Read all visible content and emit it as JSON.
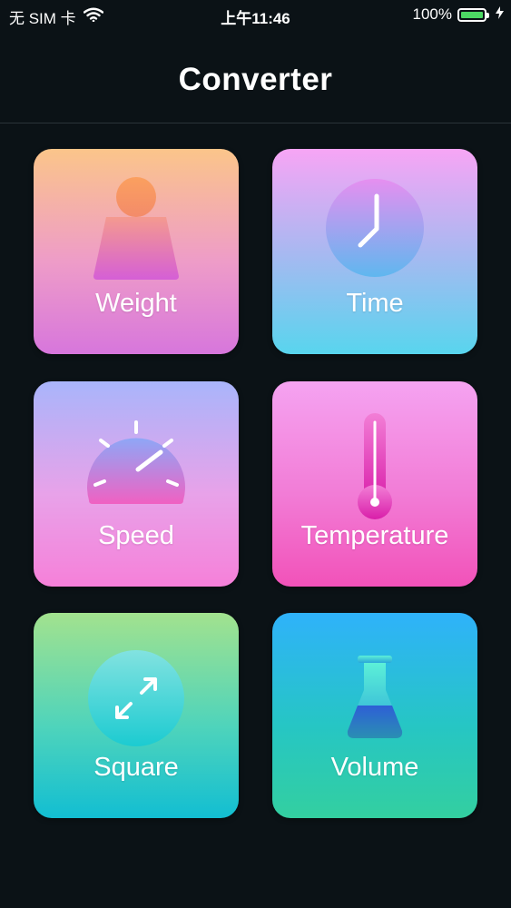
{
  "status_bar": {
    "carrier": "无 SIM 卡",
    "time": "上午11:46",
    "battery_percent": "100%",
    "battery_level": 1.0,
    "wifi_icon": "wifi-icon",
    "charging_icon": "bolt-icon"
  },
  "nav": {
    "title": "Converter"
  },
  "tiles": [
    {
      "id": "weight",
      "label": "Weight",
      "icon": "weight-icon"
    },
    {
      "id": "time",
      "label": "Time",
      "icon": "clock-icon"
    },
    {
      "id": "speed",
      "label": "Speed",
      "icon": "speedometer-icon"
    },
    {
      "id": "temperature",
      "label": "Temperature",
      "icon": "thermometer-icon"
    },
    {
      "id": "square",
      "label": "Square",
      "icon": "expand-arrows-icon"
    },
    {
      "id": "volume",
      "label": "Volume",
      "icon": "flask-icon"
    }
  ],
  "colors": {
    "background": "#0b1216",
    "battery_green": "#4cd964"
  }
}
